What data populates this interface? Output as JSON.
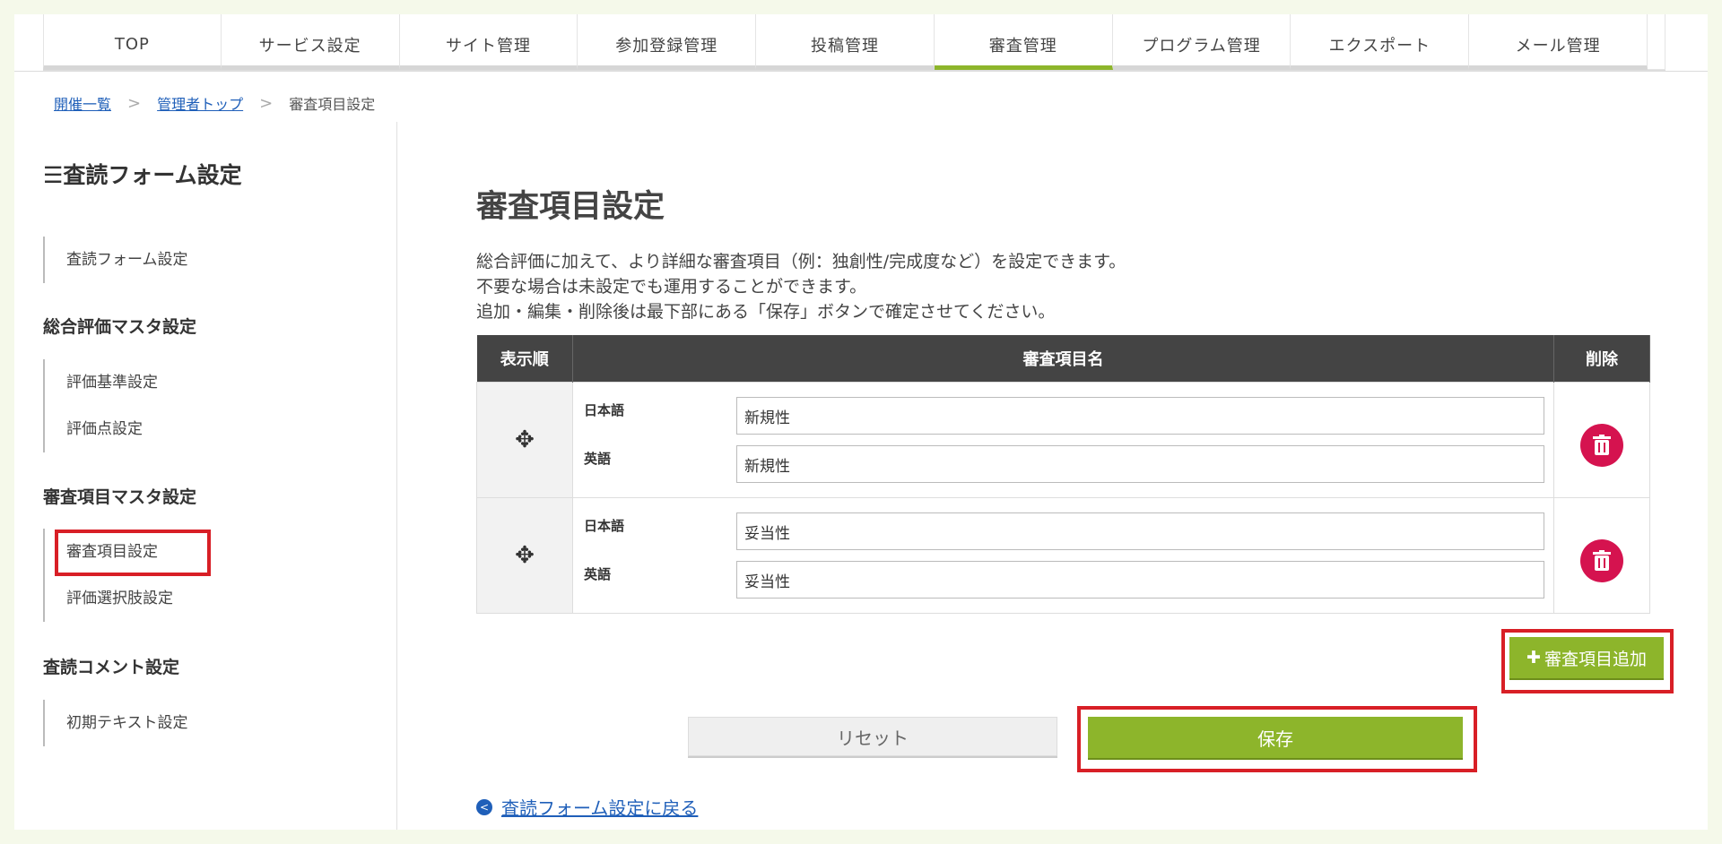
{
  "nav": {
    "tabs": [
      {
        "label": "TOP"
      },
      {
        "label": "サービス設定"
      },
      {
        "label": "サイト管理"
      },
      {
        "label": "参加登録管理"
      },
      {
        "label": "投稿管理"
      },
      {
        "label": "審査管理",
        "active": true
      },
      {
        "label": "プログラム管理"
      },
      {
        "label": "エクスポート"
      },
      {
        "label": "メール管理"
      }
    ],
    "accent_color": "#8db52b"
  },
  "breadcrumb": {
    "items": [
      "開催一覧",
      "管理者トップ"
    ],
    "current": "審査項目設定"
  },
  "sidebar": {
    "title": "査読フォーム設定",
    "title_icon": "hamburger-icon",
    "sections": [
      {
        "heading": "",
        "items": [
          "査読フォーム設定"
        ]
      },
      {
        "heading": "総合評価マスタ設定",
        "items": [
          "評価基準設定",
          "評価点設定"
        ]
      },
      {
        "heading": "審査項目マスタ設定",
        "items": [
          "審査項目設定",
          "評価選択肢設定"
        ]
      },
      {
        "heading": "査読コメント設定",
        "items": [
          "初期テキスト設定"
        ]
      }
    ]
  },
  "main": {
    "title": "審査項目設定",
    "description": [
      "総合評価に加えて、より詳細な審査項目（例：独創性/完成度など）を設定できます。",
      "不要な場合は未設定でも運用することができます。",
      "追加・編集・削除後は最下部にある「保存」ボタンで確定させてください。"
    ],
    "table": {
      "headers": [
        "表示順",
        "審査項目名",
        "削除"
      ],
      "rows": [
        {
          "ja_label": "日本語",
          "ja_value": "新規性",
          "en_label": "英語",
          "en_value": "新規性"
        },
        {
          "ja_label": "日本語",
          "ja_value": "妥当性",
          "en_label": "英語",
          "en_value": "妥当性"
        }
      ]
    },
    "add_button": "審査項目追加",
    "reset_button": "リセット",
    "save_button": "保存",
    "back_link": "査読フォーム設定に戻る",
    "delete_color": "#d5134f",
    "highlight_color": "#d81f26"
  }
}
